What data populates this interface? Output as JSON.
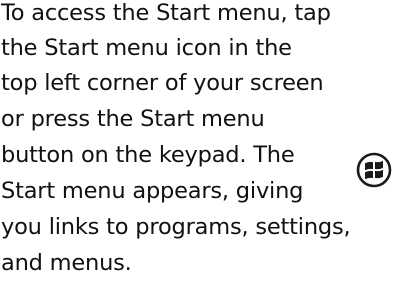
{
  "paragraph": {
    "lines": [
      "To access the Start menu, tap",
      "the Start menu icon in the",
      "top left corner of your screen",
      "or press the Start menu",
      "button on the keypad. The",
      "Start menu appears, giving",
      "you links to programs, settings,",
      "and menus."
    ]
  },
  "icon": {
    "name": "windows-start-icon",
    "color": "#1a1a1a"
  }
}
